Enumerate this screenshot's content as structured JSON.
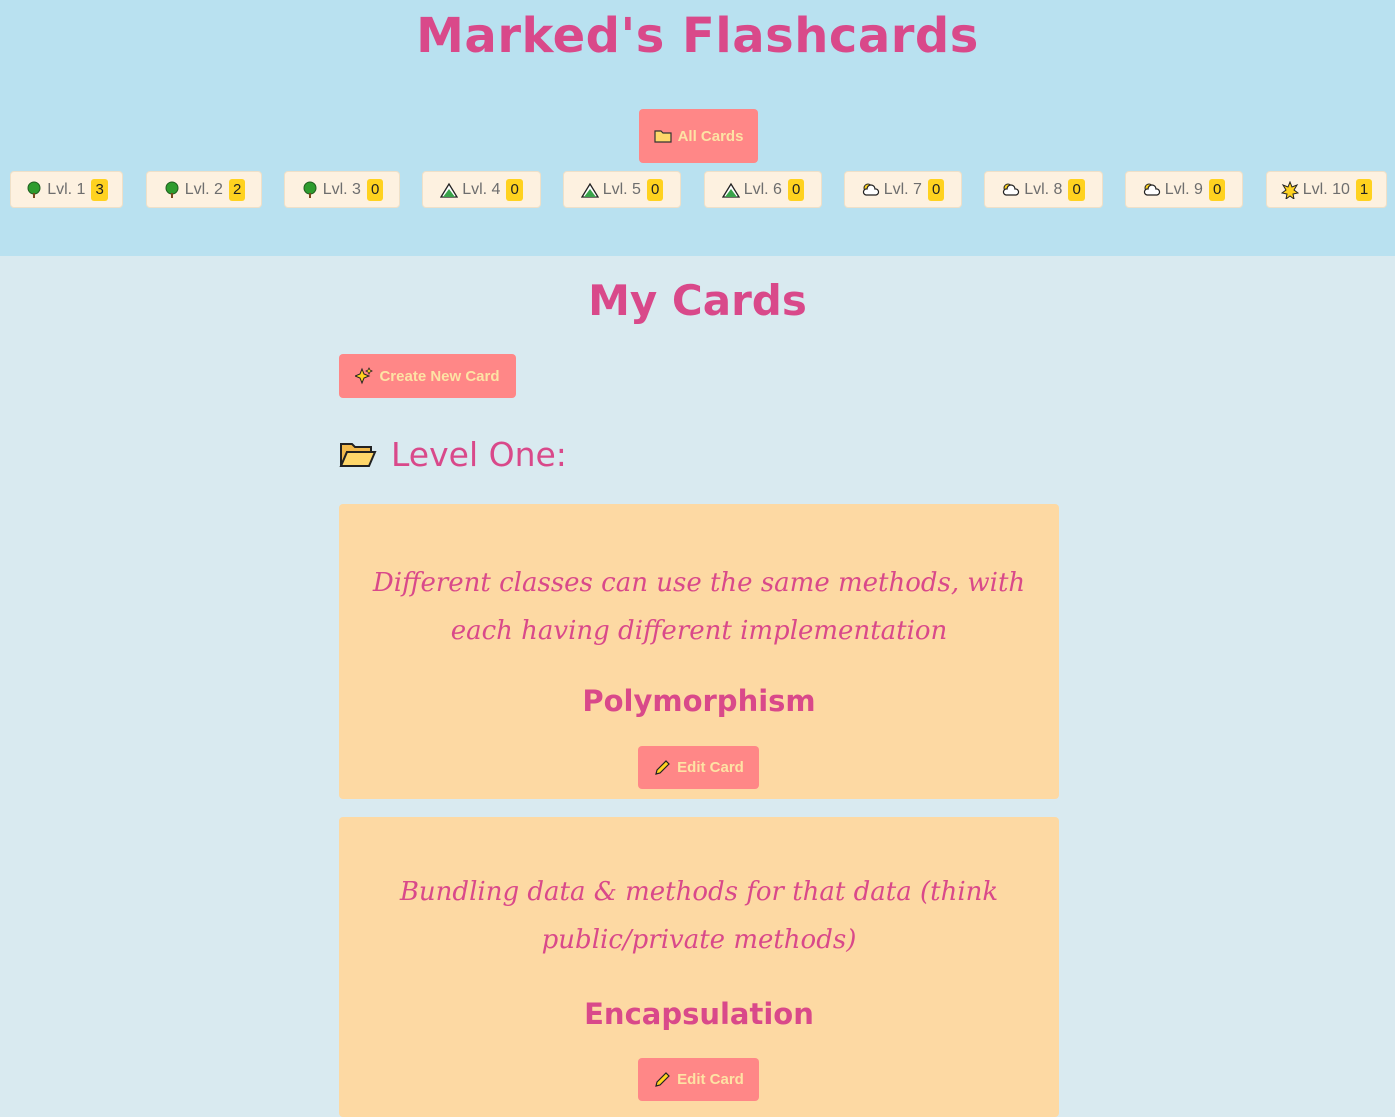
{
  "header": {
    "title": "Marked's Flashcards",
    "all_cards": {
      "label": "All Cards",
      "icon": "folder-icon"
    }
  },
  "levels": [
    {
      "label": "Lvl. 1",
      "count": "3",
      "icon": "tree-icon"
    },
    {
      "label": "Lvl. 2",
      "count": "2",
      "icon": "tree-icon"
    },
    {
      "label": "Lvl. 3",
      "count": "0",
      "icon": "tree-icon"
    },
    {
      "label": "Lvl. 4",
      "count": "0",
      "icon": "mountain-icon"
    },
    {
      "label": "Lvl. 5",
      "count": "0",
      "icon": "mountain-icon"
    },
    {
      "label": "Lvl. 6",
      "count": "0",
      "icon": "mountain-icon"
    },
    {
      "label": "Lvl. 7",
      "count": "0",
      "icon": "cloud-icon"
    },
    {
      "label": "Lvl. 8",
      "count": "0",
      "icon": "cloud-icon"
    },
    {
      "label": "Lvl. 9",
      "count": "0",
      "icon": "cloud-icon"
    },
    {
      "label": "Lvl. 10",
      "count": "1",
      "icon": "star-burst-icon"
    }
  ],
  "main": {
    "title": "My Cards",
    "create_button": {
      "label": "Create New Card",
      "icon": "sparkles-icon"
    },
    "level_heading": {
      "label": "Level One:",
      "icon": "open-folder-icon"
    },
    "cards": [
      {
        "definition": "Different classes can use the same methods, with each having different implementation",
        "term": "Polymorphism",
        "edit_label": "Edit Card"
      },
      {
        "definition": "Bundling data & methods for that data (think public/private methods)",
        "term": "Encapsulation",
        "edit_label": "Edit Card"
      }
    ]
  },
  "colors": {
    "header_bg": "#b9e1f0",
    "page_bg": "#d9eaf0",
    "accent_pink": "#d9498a",
    "button_bg": "#ff8787",
    "button_text": "#fde3a4",
    "card_bg": "#fdd9a3",
    "badge": "#ffd21f"
  }
}
